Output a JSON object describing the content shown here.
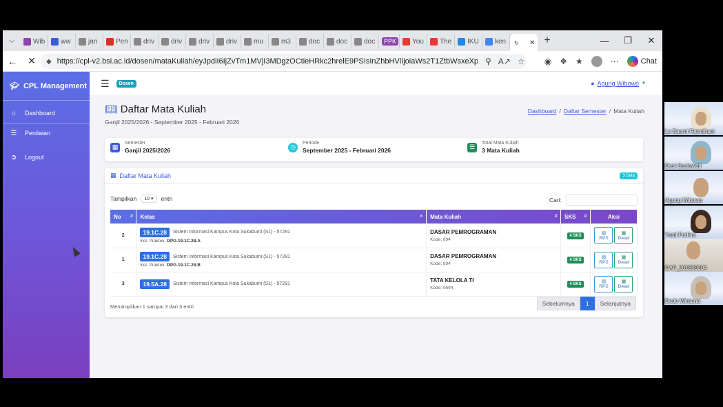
{
  "browser": {
    "tabs": [
      {
        "label": "Wib",
        "icon": "ppk-favicon"
      },
      {
        "label": "ww",
        "icon": "k-favicon"
      },
      {
        "label": "jan",
        "icon": "globe-favicon"
      },
      {
        "label": "Pen",
        "icon": "gmail-favicon"
      },
      {
        "label": "driv",
        "icon": "globe-favicon"
      },
      {
        "label": "driv",
        "icon": "globe-favicon"
      },
      {
        "label": "driv",
        "icon": "globe-favicon"
      },
      {
        "label": "driv",
        "icon": "globe-favicon"
      },
      {
        "label": "mu",
        "icon": "globe-favicon"
      },
      {
        "label": "m3",
        "icon": "globe-favicon"
      },
      {
        "label": "doc",
        "icon": "globe-favicon"
      },
      {
        "label": "doc",
        "icon": "globe-favicon"
      },
      {
        "label": "doc",
        "icon": "globe-favicon"
      },
      {
        "label": "PPK",
        "icon": "ppk-favicon"
      },
      {
        "label": "You",
        "icon": "youtube-favicon"
      },
      {
        "label": "The",
        "icon": "youtube-favicon"
      },
      {
        "label": "IKU",
        "icon": "drive-favicon"
      },
      {
        "label": "ken",
        "icon": "google-favicon"
      }
    ],
    "url": "https://cpl-v2.bsi.ac.id/dosen/mataKuliah/eyJpdiI6IjZvTm1MVjI3MDgzOCtieHRkc2hrelE9PSIsInZhbHVlIjoiaWs2T1ZtbWsxeXp1Q0Jy...",
    "chat_label": "Chat"
  },
  "sidebar": {
    "brand": "CPL Management",
    "items": [
      {
        "label": "Dashboard",
        "icon": "home-icon"
      },
      {
        "label": "Penilaian",
        "icon": "list-icon"
      },
      {
        "label": "Logout",
        "icon": "logout-icon"
      }
    ]
  },
  "topbar": {
    "role_badge": "Dosen",
    "user_name": "Agung Wibowo"
  },
  "page": {
    "title": "Daftar Mata Kuliah",
    "subtitle": "Ganjil 2025/2026 - September 2025 - Februari 2026",
    "breadcrumb": [
      "Dashboard",
      "Daftar Semester",
      "Mata Kuliah"
    ]
  },
  "info": {
    "semester_label": "Semester",
    "semester_value": "Ganjil 2025/2026",
    "periode_label": "Periode",
    "periode_value": "September 2025 - Februari 2026",
    "total_label": "Total Mata Kuliah",
    "total_value": "3 Mata Kuliah"
  },
  "table_card": {
    "title": "Daftar Mata Kuliah",
    "count_badge": "3 Data",
    "show_label": "Tampilkan",
    "show_value": "10",
    "entries_label": "entri",
    "search_label": "Cari:",
    "columns": [
      "No",
      "Kelas",
      "Mata Kuliah",
      "SKS",
      "Aksi"
    ],
    "rows": [
      {
        "no": "2",
        "kelas": "19.1C.28",
        "prodi": "Sistem Informasi Kampus Kota Sukabumi (S1) - 57281",
        "praktek_label": "Kel. Praktek:",
        "praktek": "DPG.19.1C.28.A",
        "mk": "DASAR PEMROGRAMAN",
        "kode": "Kode: 894",
        "sks": "4 SKS",
        "rps": "RPS",
        "detail": "Detail"
      },
      {
        "no": "1",
        "kelas": "19.1C.28",
        "prodi": "Sistem Informasi Kampus Kota Sukabumi (S1) - 57281",
        "praktek_label": "Kel. Praktek:",
        "praktek": "DPG.19.1C.28.B",
        "mk": "DASAR PEMROGRAMAN",
        "kode": "Kode: 894",
        "sks": "4 SKS",
        "rps": "RPS",
        "detail": "Detail"
      },
      {
        "no": "3",
        "kelas": "19.5A.28",
        "prodi": "Sistem Informasi Kampus Kota Sukabumi (S1) - 57281",
        "praktek_label": "",
        "praktek": "",
        "mk": "TATA KELOLA TI",
        "kode": "Kode: 0694",
        "sks": "4 SKS",
        "rps": "RPS",
        "detail": "Detail"
      }
    ],
    "footer": "Menampilkan 1 sampai 3 dari 3 entri",
    "pager": {
      "prev": "Sebelumnya",
      "current": "1",
      "next": "Selanjutnya"
    }
  },
  "participants": [
    {
      "name": "Ls Saumi Ramdhani"
    },
    {
      "name": "Desi Suslawati"
    },
    {
      "name": "Agung Wibowo"
    },
    {
      "name": "Yusti Farlina"
    },
    {
      "name": "DAF_201809204"
    },
    {
      "name": "Dede Wintana"
    }
  ],
  "colors": {
    "sidebar_top": "#5b6ee6",
    "sidebar_bottom": "#7a3fc0",
    "accent": "#3b5bdb",
    "class_badge": "#2f6fe0",
    "sks_badge": "#1f8f5a",
    "data_badge": "#1ec8d9"
  }
}
